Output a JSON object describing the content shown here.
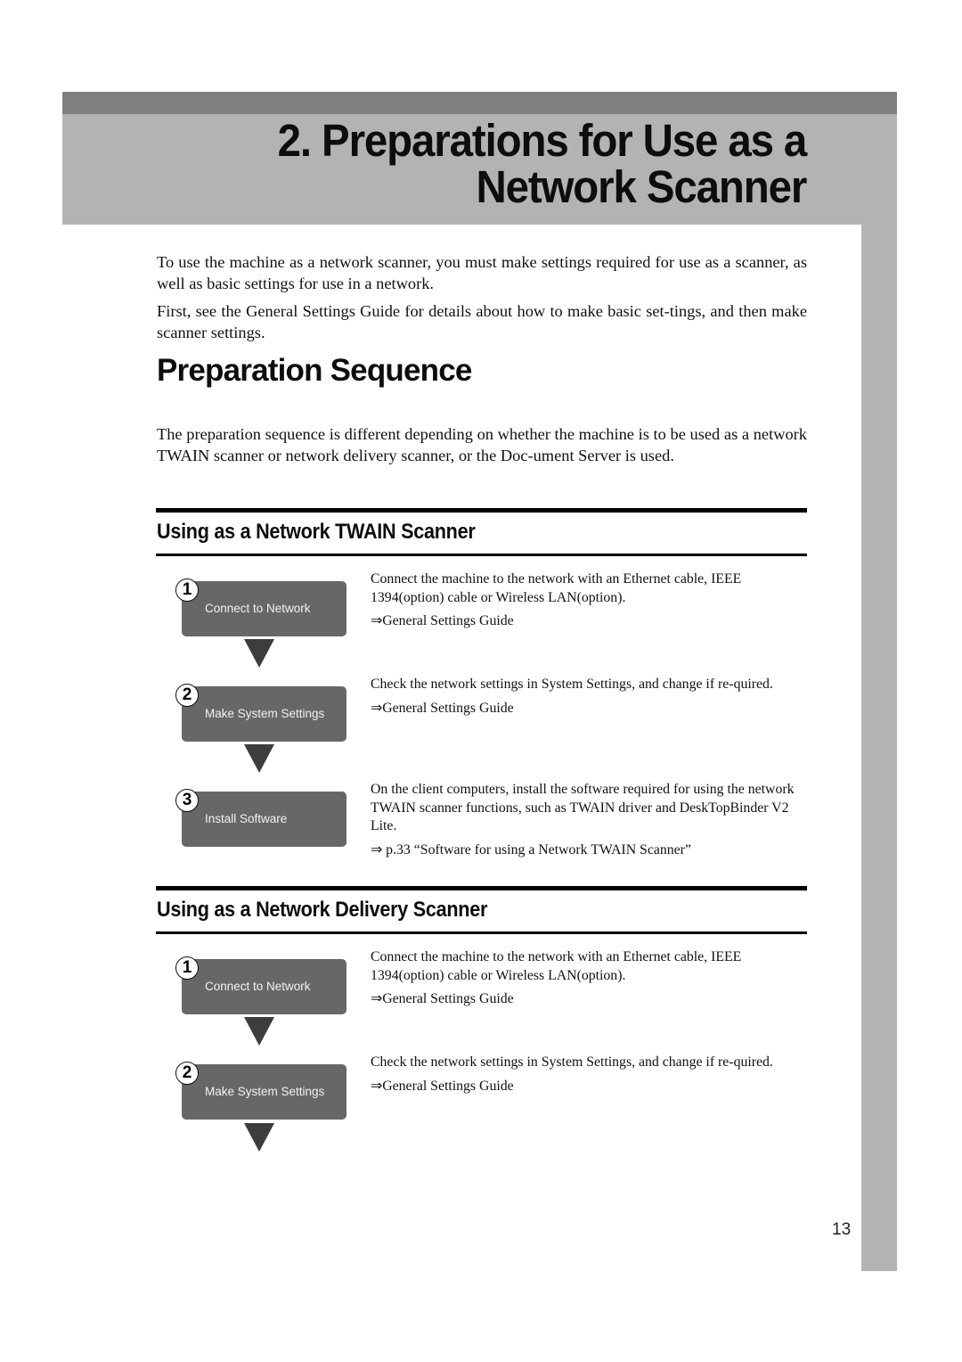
{
  "chapter": {
    "title_line1": "2. Preparations for Use as a",
    "title_line2": "Network Scanner"
  },
  "intro": {
    "paragraph1": "To use the machine as a network scanner, you must make settings required for use as a scanner, as well as basic settings for use in a network.",
    "paragraph2": "First, see the General Settings Guide for details about how to make basic set-tings, and then make scanner settings."
  },
  "section": {
    "heading": "Preparation Sequence",
    "paragraph": "The preparation sequence is different depending on whether the machine is to be used as a network TWAIN scanner or network delivery scanner, or the Doc-ument Server is used."
  },
  "twain": {
    "heading": "Using as a Network TWAIN Scanner",
    "steps": [
      {
        "number": "1",
        "label": "Connect to Network",
        "description": "Connect the machine to the network with an Ethernet cable, IEEE 1394(option) cable or Wireless LAN(option).",
        "reference": "⇒General Settings Guide"
      },
      {
        "number": "2",
        "label": "Make System Settings",
        "description": "Check the network settings in System Settings, and change if re-quired.",
        "reference": "⇒General Settings Guide"
      },
      {
        "number": "3",
        "label": "Install Software",
        "description": "On the client computers, install the software required for using the network TWAIN scanner functions, such as TWAIN driver and DeskTopBinder V2 Lite.",
        "reference": "⇒ p.33 “Software for using a Network TWAIN Scanner”"
      }
    ]
  },
  "delivery": {
    "heading": "Using as a Network Delivery Scanner",
    "steps": [
      {
        "number": "1",
        "label": "Connect to Network",
        "description": "Connect the machine to the network with an Ethernet cable, IEEE 1394(option) cable or Wireless LAN(option).",
        "reference": "⇒General Settings Guide"
      },
      {
        "number": "2",
        "label": "Make System Settings",
        "description": "Check the network settings in System Settings, and change if re-quired.",
        "reference": "⇒General Settings Guide"
      }
    ]
  },
  "page_number": "13"
}
